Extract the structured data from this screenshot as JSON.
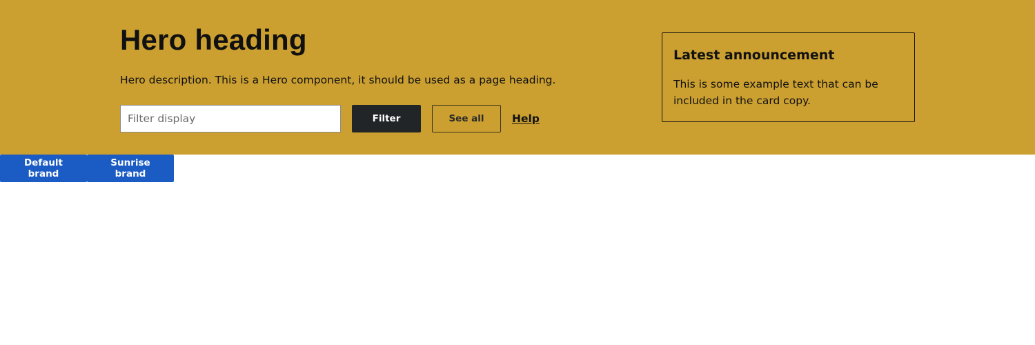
{
  "hero": {
    "title": "Hero heading",
    "description": "Hero description. This is a Hero component, it should be used as a page heading.",
    "background_color": "#cca030",
    "filter_input": {
      "value": "",
      "placeholder": "Filter display"
    },
    "filter_button_label": "Filter",
    "see_all_button_label": "See all",
    "help_link_label": "Help"
  },
  "card": {
    "title": "Latest announcement",
    "copy": "This is some example text that can be included in the card copy."
  },
  "brand_switcher": {
    "button_color": "#1a5bc4",
    "items": [
      {
        "label": "Default brand"
      },
      {
        "label": "Sunrise brand"
      }
    ]
  }
}
